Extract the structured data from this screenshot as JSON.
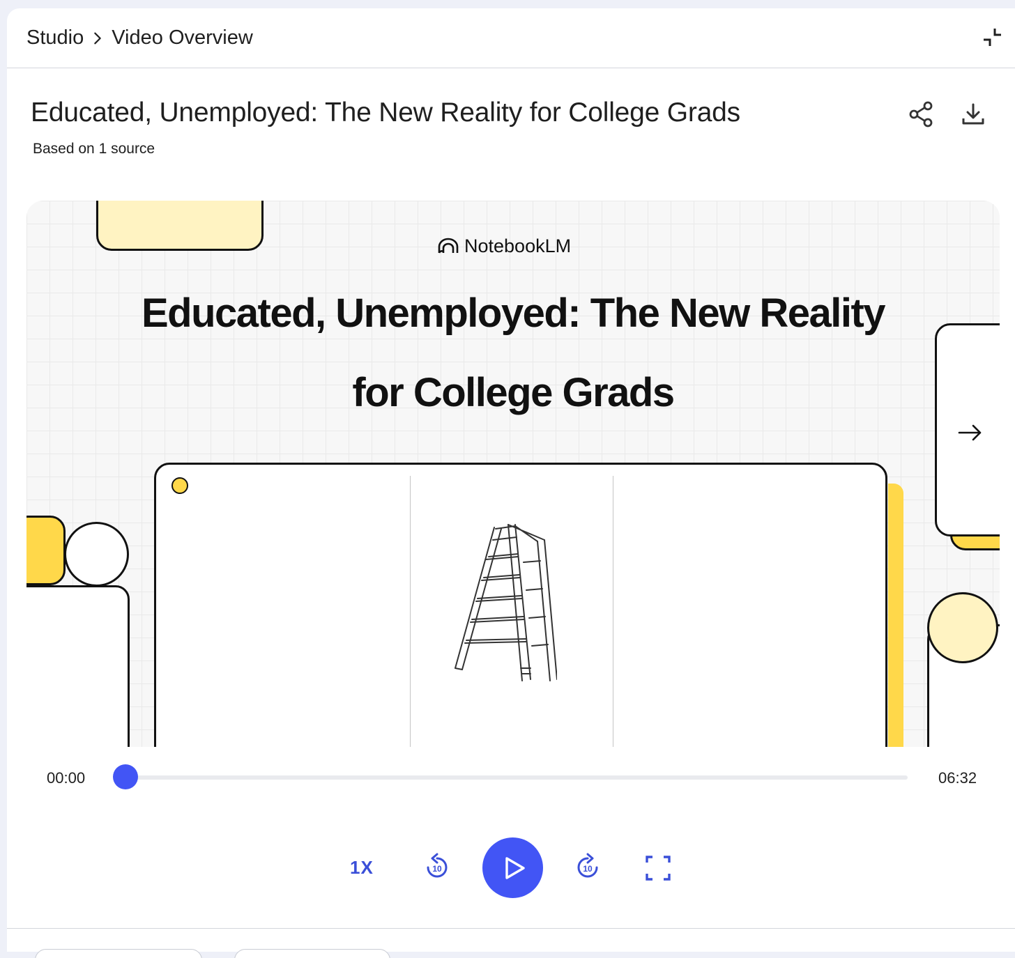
{
  "breadcrumb": {
    "root": "Studio",
    "current": "Video Overview"
  },
  "title": "Educated, Unemployed: The New Reality for College Grads",
  "subtitle": "Based on 1 source",
  "slide": {
    "brand": "NotebookLM",
    "title_line1": "Educated, Unemployed: The New Reality",
    "title_line2": "for College Grads"
  },
  "player": {
    "current_time": "00:00",
    "duration": "06:32",
    "progress": 0,
    "speed_label": "1X",
    "rewind_label": "10",
    "forward_label": "10"
  },
  "colors": {
    "accent": "#4255f5",
    "yellow": "#ffd84a",
    "pale_yellow": "#fff3c2"
  },
  "icons": {
    "collapse": "collapse-icon",
    "share": "share-icon",
    "download": "download-icon",
    "next": "arrow-right-icon",
    "rewind": "replay-10-icon",
    "play": "play-icon",
    "forward": "forward-10-icon",
    "fullscreen": "fullscreen-icon"
  }
}
